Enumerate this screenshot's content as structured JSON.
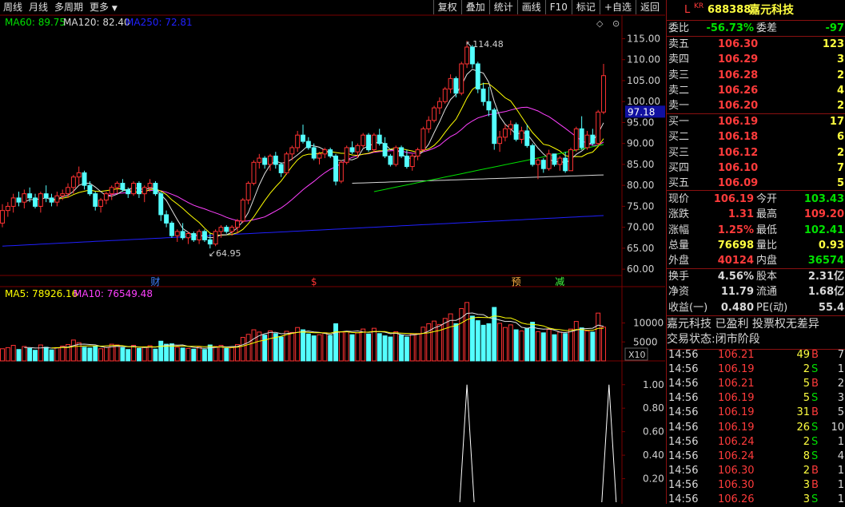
{
  "toolbar": {
    "left": [
      "周线",
      "月线",
      "多周期",
      "更多"
    ],
    "right": [
      "复权",
      "叠加",
      "统计",
      "画线",
      "F10",
      "标记",
      "+自选",
      "返回"
    ]
  },
  "price_legend": {
    "ma60": "MA60: 89.75",
    "ma120": "MA120: 82.40",
    "ma250": "MA250: 72.81"
  },
  "volume_legend": {
    "ma5": "MA5: 78926.16",
    "ma10": "MA10: 76549.48"
  },
  "indicator_label": "X10",
  "price_marker": "97.18",
  "annotations": {
    "high": "114.48",
    "low": "64.95"
  },
  "event_marks": [
    "财",
    "$",
    "预",
    "减"
  ],
  "colors": {
    "up": "#ff3232",
    "down": "#54ffff",
    "ma5": "#e0e0e0",
    "ma10": "#ffff00",
    "ma20": "#ff40ff",
    "ma60": "#00e000",
    "ma120": "#d8d8d8",
    "ma250": "#2020ff",
    "grid": "#7a0000"
  },
  "chart_data": [
    {
      "type": "candlestick",
      "yticks": [
        "115.00",
        "110.00",
        "105.00",
        "100.00",
        "95.00",
        "90.00",
        "85.00",
        "80.00",
        "75.00",
        "70.00",
        "65.00",
        "60.00"
      ],
      "ylim": [
        58.5,
        117
      ],
      "candles": [
        [
          71.0,
          75.5,
          70.0,
          74.0
        ],
        [
          74.0,
          76.0,
          72.5,
          75.0
        ],
        [
          75.0,
          78.0,
          73.5,
          77.0
        ],
        [
          77.0,
          78.5,
          75.0,
          76.0
        ],
        [
          76.0,
          79.0,
          74.5,
          78.0
        ],
        [
          78.0,
          79.5,
          76.0,
          77.0
        ],
        [
          77.0,
          78.0,
          74.5,
          75.0
        ],
        [
          75.0,
          78.5,
          73.5,
          78.0
        ],
        [
          78.0,
          80.0,
          76.0,
          77.0
        ],
        [
          77.0,
          78.0,
          75.0,
          76.0
        ],
        [
          76.0,
          78.5,
          75.0,
          77.5
        ],
        [
          77.5,
          79.0,
          76.5,
          78.0
        ],
        [
          78.0,
          80.5,
          77.0,
          79.5
        ],
        [
          79.5,
          82.5,
          78.0,
          82.0
        ],
        [
          82.0,
          84.5,
          80.0,
          83.0
        ],
        [
          83.0,
          83.5,
          79.0,
          80.0
        ],
        [
          80.0,
          81.0,
          77.5,
          78.0
        ],
        [
          78.0,
          78.5,
          74.0,
          75.0
        ],
        [
          75.0,
          77.0,
          73.5,
          76.5
        ],
        [
          76.5,
          78.5,
          75.5,
          78.0
        ],
        [
          78.0,
          80.0,
          76.5,
          79.5
        ],
        [
          79.5,
          81.0,
          78.0,
          80.5
        ],
        [
          80.5,
          81.5,
          78.5,
          79.0
        ],
        [
          79.0,
          79.5,
          77.0,
          78.0
        ],
        [
          78.0,
          81.0,
          77.5,
          80.5
        ],
        [
          80.5,
          81.0,
          77.0,
          78.0
        ],
        [
          78.0,
          80.0,
          76.0,
          79.5
        ],
        [
          79.5,
          81.5,
          78.5,
          80.5
        ],
        [
          80.5,
          81.0,
          77.5,
          78.0
        ],
        [
          78.0,
          78.5,
          71.5,
          73.0
        ],
        [
          73.0,
          74.0,
          70.0,
          71.0
        ],
        [
          71.0,
          71.5,
          67.5,
          68.0
        ],
        [
          68.0,
          69.5,
          66.5,
          69.0
        ],
        [
          69.0,
          71.0,
          67.0,
          67.5
        ],
        [
          67.5,
          69.0,
          66.0,
          68.5
        ],
        [
          68.5,
          69.0,
          66.5,
          67.0
        ],
        [
          67.0,
          69.5,
          66.0,
          69.0
        ],
        [
          69.0,
          69.5,
          66.5,
          67.0
        ],
        [
          67.0,
          68.5,
          64.95,
          66.0
        ],
        [
          66.0,
          69.5,
          65.5,
          69.0
        ],
        [
          69.0,
          70.5,
          67.5,
          70.0
        ],
        [
          70.0,
          70.5,
          68.5,
          69.0
        ],
        [
          69.0,
          70.5,
          68.0,
          70.0
        ],
        [
          70.0,
          72.0,
          68.5,
          71.5
        ],
        [
          71.5,
          77.0,
          71.0,
          76.5
        ],
        [
          76.5,
          81.0,
          75.5,
          80.5
        ],
        [
          80.5,
          86.0,
          80.0,
          85.5
        ],
        [
          85.5,
          87.5,
          84.0,
          86.5
        ],
        [
          86.5,
          87.0,
          84.0,
          85.0
        ],
        [
          85.0,
          87.5,
          83.5,
          87.0
        ],
        [
          87.0,
          88.0,
          84.0,
          85.0
        ],
        [
          85.0,
          85.5,
          82.0,
          83.0
        ],
        [
          83.0,
          88.0,
          82.5,
          87.5
        ],
        [
          87.5,
          89.5,
          86.0,
          89.0
        ],
        [
          89.0,
          93.0,
          88.0,
          92.0
        ],
        [
          92.0,
          94.5,
          90.0,
          90.5
        ],
        [
          90.5,
          91.5,
          88.5,
          89.0
        ],
        [
          89.0,
          90.0,
          86.0,
          86.5
        ],
        [
          86.5,
          88.0,
          85.0,
          87.5
        ],
        [
          87.5,
          89.0,
          86.5,
          88.5
        ],
        [
          88.5,
          89.0,
          86.5,
          87.0
        ],
        [
          87.0,
          87.5,
          80.0,
          81.0
        ],
        [
          81.0,
          86.0,
          80.5,
          85.5
        ],
        [
          85.5,
          89.5,
          85.0,
          89.0
        ],
        [
          89.0,
          90.5,
          87.5,
          88.0
        ],
        [
          88.0,
          90.0,
          86.5,
          89.5
        ],
        [
          89.5,
          92.5,
          89.0,
          92.0
        ],
        [
          92.0,
          92.5,
          88.0,
          88.5
        ],
        [
          88.5,
          92.5,
          88.0,
          92.0
        ],
        [
          92.0,
          93.5,
          89.5,
          90.0
        ],
        [
          90.0,
          91.5,
          86.5,
          87.0
        ],
        [
          87.0,
          87.5,
          84.5,
          85.0
        ],
        [
          85.0,
          89.5,
          84.5,
          89.0
        ],
        [
          89.0,
          89.5,
          86.5,
          87.0
        ],
        [
          87.0,
          88.5,
          84.0,
          84.5
        ],
        [
          84.5,
          87.5,
          83.5,
          87.0
        ],
        [
          87.0,
          89.0,
          86.0,
          88.5
        ],
        [
          88.5,
          94.0,
          88.0,
          93.5
        ],
        [
          93.5,
          96.5,
          92.5,
          95.5
        ],
        [
          95.5,
          99.0,
          95.0,
          98.5
        ],
        [
          98.5,
          101.0,
          97.0,
          100.0
        ],
        [
          100.0,
          103.5,
          99.5,
          103.0
        ],
        [
          103.0,
          106.5,
          102.0,
          105.5
        ],
        [
          105.5,
          106.0,
          101.0,
          102.0
        ],
        [
          102.0,
          109.5,
          101.5,
          109.0
        ],
        [
          109.0,
          114.48,
          108.0,
          113.0
        ],
        [
          113.0,
          113.5,
          108.0,
          109.0
        ],
        [
          109.0,
          109.5,
          102.0,
          103.0
        ],
        [
          103.0,
          104.5,
          99.0,
          100.0
        ],
        [
          100.0,
          103.5,
          96.5,
          98.0
        ],
        [
          98.0,
          98.5,
          88.5,
          90.0
        ],
        [
          90.0,
          93.0,
          88.0,
          91.5
        ],
        [
          91.5,
          94.5,
          90.5,
          93.5
        ],
        [
          93.5,
          95.5,
          92.0,
          94.5
        ],
        [
          94.5,
          95.0,
          90.5,
          91.0
        ],
        [
          91.0,
          94.0,
          90.0,
          93.0
        ],
        [
          93.0,
          94.5,
          89.0,
          89.5
        ],
        [
          89.5,
          90.0,
          84.5,
          85.0
        ],
        [
          85.0,
          86.5,
          81.5,
          86.0
        ],
        [
          86.0,
          86.5,
          83.0,
          84.0
        ],
        [
          84.0,
          88.5,
          83.5,
          87.5
        ],
        [
          87.5,
          87.5,
          84.5,
          85.0
        ],
        [
          85.0,
          87.0,
          83.5,
          86.5
        ],
        [
          86.5,
          88.0,
          83.0,
          83.5
        ],
        [
          83.5,
          89.0,
          83.5,
          88.5
        ],
        [
          88.5,
          94.0,
          88.0,
          93.5
        ],
        [
          93.5,
          96.5,
          88.5,
          89.0
        ],
        [
          89.0,
          93.0,
          88.5,
          92.0
        ],
        [
          92.0,
          93.5,
          89.5,
          90.0
        ],
        [
          90.0,
          98.0,
          89.5,
          97.5
        ],
        [
          97.5,
          109.0,
          97.0,
          106.19
        ]
      ]
    },
    {
      "type": "bar",
      "name": "volume",
      "yticks": [
        "10000",
        "5000"
      ],
      "ylim": [
        0,
        16000
      ],
      "values": [
        3200,
        3500,
        4100,
        3000,
        3800,
        3300,
        2800,
        4200,
        3600,
        2900,
        3500,
        3900,
        4300,
        5500,
        4800,
        3600,
        3400,
        3900,
        3200,
        3600,
        4400,
        4200,
        3500,
        3000,
        4100,
        3300,
        3700,
        4000,
        3100,
        5200,
        4400,
        4500,
        3600,
        3400,
        3300,
        3100,
        3700,
        3000,
        4200,
        3800,
        4100,
        3300,
        3500,
        4300,
        6200,
        7000,
        8200,
        7600,
        6800,
        7900,
        7200,
        6300,
        7800,
        7500,
        8800,
        8200,
        7100,
        6600,
        6900,
        7400,
        6700,
        9800,
        7600,
        7800,
        6900,
        7400,
        8400,
        7100,
        8600,
        7200,
        6600,
        6300,
        7700,
        6800,
        6300,
        7100,
        7200,
        8900,
        9800,
        10500,
        9600,
        11200,
        12400,
        9800,
        13800,
        15400,
        11800,
        10600,
        9400,
        9800,
        14100,
        9900,
        8800,
        9500,
        8200,
        7900,
        8600,
        10200,
        7700,
        7400,
        8300,
        6900,
        7600,
        7200,
        8400,
        10400,
        8700,
        7900,
        7600,
        12600,
        8900
      ]
    },
    {
      "type": "line",
      "name": "indicator",
      "yticks": [
        "1.00",
        "0.80",
        "0.60",
        "0.40",
        "0.20"
      ],
      "ylim": [
        0,
        1.08
      ],
      "spikes": [
        85,
        111
      ]
    }
  ],
  "quote": {
    "header": {
      "prefix": "L",
      "sup": "KR",
      "code": "688388",
      "name": "嘉元科技"
    },
    "weibi": {
      "label": "委比",
      "value": "-56.73%",
      "label2": "委差",
      "value2": "-97"
    },
    "sells": [
      {
        "label": "卖五",
        "price": "106.30",
        "vol": "123"
      },
      {
        "label": "卖四",
        "price": "106.29",
        "vol": "3"
      },
      {
        "label": "卖三",
        "price": "106.28",
        "vol": "2"
      },
      {
        "label": "卖二",
        "price": "106.26",
        "vol": "4"
      },
      {
        "label": "卖一",
        "price": "106.20",
        "vol": "2"
      }
    ],
    "buys": [
      {
        "label": "买一",
        "price": "106.19",
        "vol": "17"
      },
      {
        "label": "买二",
        "price": "106.18",
        "vol": "6"
      },
      {
        "label": "买三",
        "price": "106.12",
        "vol": "2"
      },
      {
        "label": "买四",
        "price": "106.10",
        "vol": "7"
      },
      {
        "label": "买五",
        "price": "106.09",
        "vol": "5"
      }
    ],
    "stats": [
      {
        "l1": "现价",
        "v1": "106.19",
        "c1": "r",
        "l2": "今开",
        "v2": "103.43",
        "c2": "g"
      },
      {
        "l1": "涨跌",
        "v1": "1.31",
        "c1": "r",
        "l2": "最高",
        "v2": "109.20",
        "c2": "r"
      },
      {
        "l1": "涨幅",
        "v1": "1.25%",
        "c1": "r",
        "l2": "最低",
        "v2": "102.41",
        "c2": "g"
      },
      {
        "l1": "总量",
        "v1": "76698",
        "c1": "y",
        "l2": "量比",
        "v2": "0.93",
        "c2": "y"
      },
      {
        "l1": "外盘",
        "v1": "40124",
        "c1": "r",
        "l2": "内盘",
        "v2": "36574",
        "c2": "g"
      }
    ],
    "fund": [
      {
        "l1": "换手",
        "v1": "4.56%",
        "l2": "股本",
        "v2": "2.31亿"
      },
      {
        "l1": "净资",
        "v1": "11.79",
        "l2": "流通",
        "v2": "1.68亿"
      },
      {
        "l1": "收益(一)",
        "v1": "0.480",
        "l2": "PE(动)",
        "v2": "55.4"
      }
    ],
    "tags": "嘉元科技 已盈利 投票权无差异",
    "trade_state": "交易状态:闭市阶段",
    "ticks": [
      {
        "t": "14:56",
        "p": "106.21",
        "v": "49",
        "s": "B",
        "n": "7"
      },
      {
        "t": "14:56",
        "p": "106.19",
        "v": "2",
        "s": "S",
        "n": "1"
      },
      {
        "t": "14:56",
        "p": "106.21",
        "v": "5",
        "s": "B",
        "n": "2"
      },
      {
        "t": "14:56",
        "p": "106.19",
        "v": "5",
        "s": "S",
        "n": "3"
      },
      {
        "t": "14:56",
        "p": "106.19",
        "v": "31",
        "s": "B",
        "n": "5"
      },
      {
        "t": "14:56",
        "p": "106.19",
        "v": "26",
        "s": "S",
        "n": "10"
      },
      {
        "t": "14:56",
        "p": "106.24",
        "v": "2",
        "s": "S",
        "n": "1"
      },
      {
        "t": "14:56",
        "p": "106.24",
        "v": "8",
        "s": "S",
        "n": "4"
      },
      {
        "t": "14:56",
        "p": "106.30",
        "v": "2",
        "s": "B",
        "n": "1"
      },
      {
        "t": "14:56",
        "p": "106.30",
        "v": "3",
        "s": "B",
        "n": "1"
      },
      {
        "t": "14:56",
        "p": "106.26",
        "v": "3",
        "s": "S",
        "n": "1"
      }
    ]
  }
}
